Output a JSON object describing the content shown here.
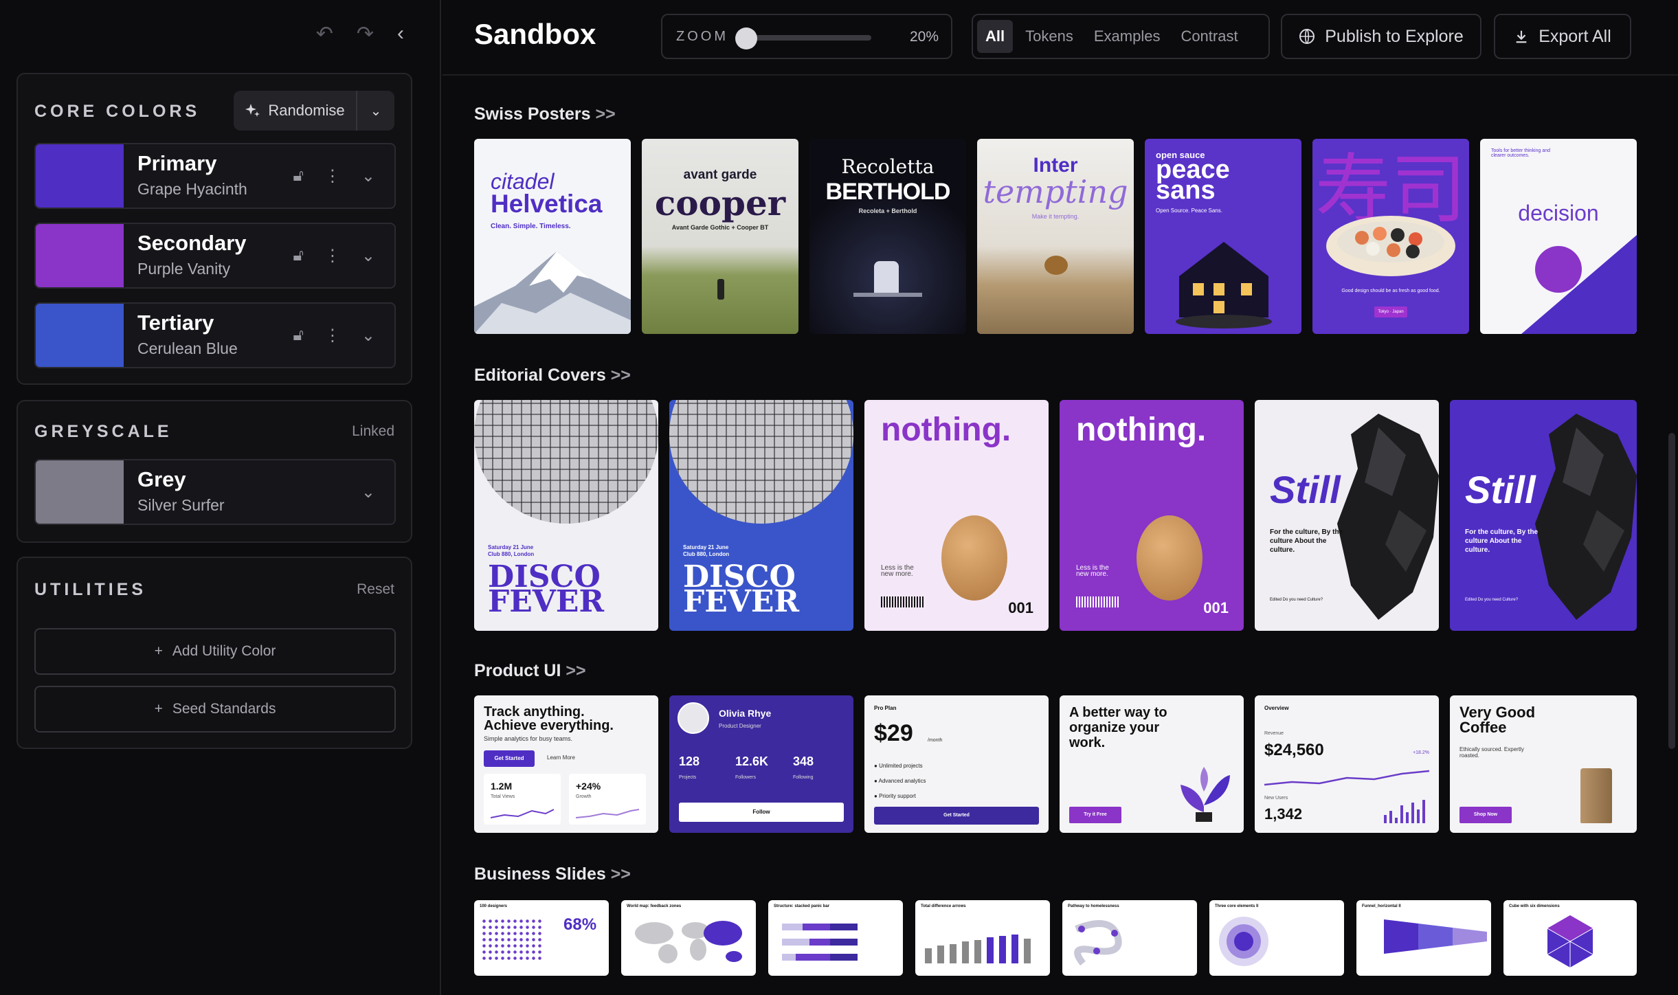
{
  "toolbar": {
    "undo": "↶",
    "redo": "↷",
    "collapse": "‹"
  },
  "core": {
    "title": "CORE COLORS",
    "randomise": "Randomise",
    "colors": [
      {
        "name": "Primary",
        "sub": "Grape Hyacinth",
        "hex": "#4f2ec4"
      },
      {
        "name": "Secondary",
        "sub": "Purple Vanity",
        "hex": "#8a34c8"
      },
      {
        "name": "Tertiary",
        "sub": "Cerulean Blue",
        "hex": "#3a55c9"
      }
    ]
  },
  "greyscale": {
    "title": "GREYSCALE",
    "linked": "Linked",
    "name": "Grey",
    "sub": "Silver Surfer",
    "hex": "#7d7b88"
  },
  "utilities": {
    "title": "UTILITIES",
    "reset": "Reset",
    "add": "Add Utility Color",
    "seed": "Seed Standards"
  },
  "header": {
    "title": "Sandbox",
    "zoom_label": "ZOOM",
    "zoom_value": "20%",
    "zoom_level": 0.2,
    "tabs": [
      "All",
      "Tokens",
      "Examples",
      "Contrast"
    ],
    "publish": "Publish to Explore",
    "export": "Export All"
  },
  "sections": {
    "swiss": "Swiss Posters",
    "editorial": "Editorial Covers",
    "product": "Product UI",
    "business": "Business Slides",
    "arrows": ">>"
  },
  "swiss": [
    {
      "t1": "citadel",
      "t2": "Helvetica",
      "t3": "Clean. Simple. Timeless."
    },
    {
      "t1": "avant garde",
      "t2": "cooper",
      "t3": "Avant Garde Gothic + Cooper BT"
    },
    {
      "t1": "Recoletta",
      "t2": "BERTHOLD",
      "t3": "Recoleta + Berthold"
    },
    {
      "t1": "Inter",
      "t2": "tempting",
      "t3": "Make it tempting."
    },
    {
      "t1": "open sauce",
      "t2": "peace",
      "t3": "sans",
      "t4": "Open Source. Peace Sans."
    },
    {
      "t1": "寿司",
      "t3": "Good design should be as fresh as good food.",
      "t4": "Tokyo · Japan"
    },
    {
      "t1": "Tools for better thinking and clearer outcomes.",
      "t2": "decision"
    }
  ],
  "editorial": [
    {
      "date": "Saturday 21 June",
      "venue": "Club 880, London",
      "t1": "DISCO",
      "t2": "FEVER"
    },
    {
      "date": "Saturday 21 June",
      "venue": "Club 880, London",
      "t1": "DISCO",
      "t2": "FEVER"
    },
    {
      "t1": "nothing.",
      "small": "Less is the new more.",
      "num": "001"
    },
    {
      "t1": "nothing.",
      "small": "Less is the new more.",
      "num": "001"
    },
    {
      "t1": "Still",
      "body": "For the culture, By the culture About the culture.",
      "foot": "Edited Do you need Culture?"
    },
    {
      "t1": "Still",
      "body": "For the culture, By the culture About the culture.",
      "foot": "Edited Do you need Culture?"
    }
  ],
  "product": [
    {
      "h": "Track anything. Achieve everything.",
      "s": "Simple analytics for busy teams.",
      "b1": "Get Started",
      "b2": "Learn More",
      "m1": "1.2M",
      "m1l": "Total Views",
      "m2": "+24%",
      "m2l": "Growth"
    },
    {
      "name": "Olivia Rhye",
      "role": "Product Designer",
      "s1": "128",
      "s1l": "Projects",
      "s2": "12.6K",
      "s2l": "Followers",
      "s3": "348",
      "s3l": "Following",
      "btn": "Follow"
    },
    {
      "plan": "Pro Plan",
      "price": "$29",
      "per": "/month",
      "f1": "Unlimited projects",
      "f2": "Advanced analytics",
      "f3": "Priority support",
      "btn": "Get Started"
    },
    {
      "h": "A better way to organize your work.",
      "btn": "Try it Free"
    },
    {
      "t": "Overview",
      "rev": "Revenue",
      "v": "$24,560",
      "d": "+18.2%",
      "nu": "New Users",
      "n": "1,342"
    },
    {
      "h": "Very Good Coffee",
      "s": "Ethically sourced. Expertly roasted.",
      "btn": "Shop Now"
    }
  ],
  "business": [
    "100 designers",
    "World map: feedback zones",
    "Structure: stacked panic bar",
    "Total difference arrows",
    "Pathway to homelessness",
    "Three core elements II",
    "Funnel_horizontal II",
    "Cube with six dimensions"
  ],
  "business_extra": {
    "pct": "68%"
  }
}
